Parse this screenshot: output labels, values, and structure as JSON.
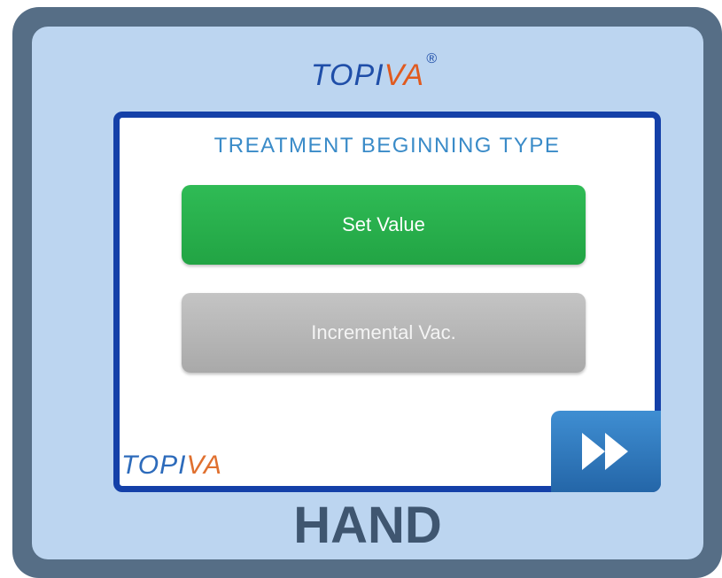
{
  "brand": {
    "logo_prefix": "TOPI",
    "logo_suffix": "VA",
    "registered": "®"
  },
  "screen": {
    "title": "TREATMENT BEGINNING TYPE",
    "options": [
      {
        "label": "Set Value",
        "state": "selected",
        "color": "#22a444"
      },
      {
        "label": "Incremental Vac.",
        "state": "unselected",
        "color": "#b0b0b0"
      }
    ],
    "next_button": {
      "icon": "fast-forward-icon"
    },
    "footer_logo": {
      "prefix": "TOPI",
      "suffix": "VA"
    }
  },
  "mode_label": "HAND",
  "colors": {
    "accent_blue": "#1440a8",
    "title_blue": "#3a8bc8",
    "frame": "#566e86",
    "panel": "#bcd5f0"
  }
}
